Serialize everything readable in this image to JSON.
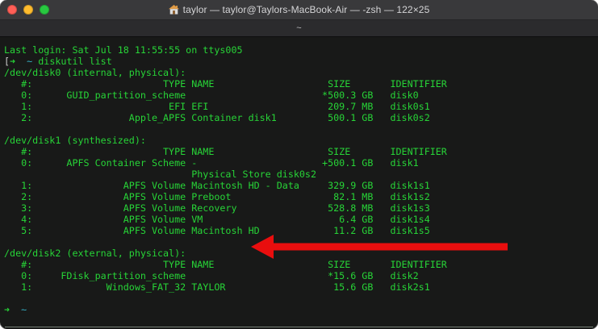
{
  "window": {
    "title": "taylor — taylor@Taylors-MacBook-Air — -zsh — 122×25",
    "tab_title": "~",
    "controls": {
      "close": "close",
      "minimize": "minimize",
      "zoom": "zoom"
    }
  },
  "colors": {
    "green": "#27d437",
    "cyan": "#36b2c8",
    "white": "#c9c9c9",
    "arrow_red": "#e90e0e",
    "term_bg": "#181918",
    "titlebar_bg": "#39393b",
    "tabbar_bg": "#2b2b2d",
    "title_fg": "#d5d5d7",
    "tab_fg": "#bebec0",
    "light_red": "#ff5f57",
    "light_yellow": "#febc2e",
    "light_green": "#28c840"
  },
  "terminal": {
    "prompt_symbol": "➜",
    "command": "diskutil list",
    "lines": [
      [
        [
          "Last login: Sat Jul 18 11:55:55 on ttys005",
          "g"
        ]
      ],
      [
        [
          "[",
          "w"
        ],
        [
          "➜",
          "g"
        ],
        [
          "  ",
          "g"
        ],
        [
          "~",
          "c"
        ],
        [
          " diskutil list",
          "g"
        ]
      ],
      [
        [
          "/dev/disk0 (internal, physical):",
          "g"
        ]
      ],
      [
        [
          "   #:                       TYPE NAME                    SIZE       IDENTIFIER",
          "g"
        ]
      ],
      [
        [
          "   0:      GUID_partition_scheme                        *500.3 GB   disk0",
          "g"
        ]
      ],
      [
        [
          "   1:                        EFI EFI                     209.7 MB   disk0s1",
          "g"
        ]
      ],
      [
        [
          "   2:                 Apple_APFS Container disk1         500.1 GB   disk0s2",
          "g"
        ]
      ],
      [],
      [
        [
          "/dev/disk1 (synthesized):",
          "g"
        ]
      ],
      [
        [
          "   #:                       TYPE NAME                    SIZE       IDENTIFIER",
          "g"
        ]
      ],
      [
        [
          "   0:      APFS Container Scheme -                      +500.1 GB   disk1",
          "g"
        ]
      ],
      [
        [
          "                                 Physical Store disk0s2",
          "g"
        ]
      ],
      [
        [
          "   1:                APFS Volume Macintosh HD - Data     329.9 GB   disk1s1",
          "g"
        ]
      ],
      [
        [
          "   2:                APFS Volume Preboot                  82.1 MB   disk1s2",
          "g"
        ]
      ],
      [
        [
          "   3:                APFS Volume Recovery                528.8 MB   disk1s3",
          "g"
        ]
      ],
      [
        [
          "   4:                APFS Volume VM                        6.4 GB   disk1s4",
          "g"
        ]
      ],
      [
        [
          "   5:                APFS Volume Macintosh HD             11.2 GB   disk1s5",
          "g"
        ]
      ],
      [],
      [
        [
          "/dev/disk2 (external, physical):",
          "g"
        ]
      ],
      [
        [
          "   #:                       TYPE NAME                    SIZE       IDENTIFIER",
          "g"
        ]
      ],
      [
        [
          "   0:     FDisk_partition_scheme                         *15.6 GB   disk2",
          "g"
        ]
      ],
      [
        [
          "   1:             Windows_FAT_32 TAYLOR                   15.6 GB   disk2s1",
          "g"
        ]
      ],
      [],
      [
        [
          "➜",
          "g"
        ],
        [
          "  ",
          "g"
        ],
        [
          "~",
          "c"
        ]
      ]
    ]
  },
  "annotation": {
    "type": "arrow",
    "direction": "left",
    "color": "#e90e0e",
    "points_to": "/dev/disk2 (external, physical):"
  }
}
